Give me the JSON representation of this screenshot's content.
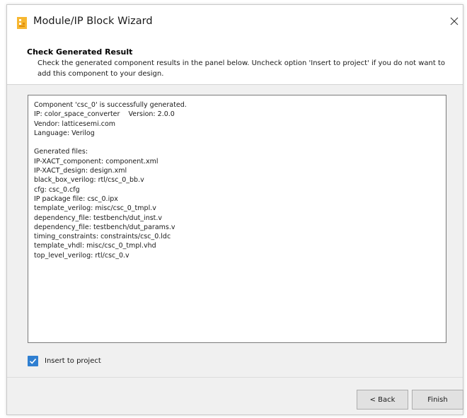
{
  "window": {
    "title": "Module/IP Block Wizard",
    "icon": "lattice-app-icon",
    "close_icon": "close-icon"
  },
  "header": {
    "title": "Check Generated Result",
    "description": "Check the generated component results in the panel below. Uncheck option 'Insert to project' if you do not want to add this component to your design."
  },
  "results_panel": {
    "lines": [
      "Component 'csc_0' is successfully generated.",
      "IP: color_space_converter    Version: 2.0.0",
      "Vendor: latticesemi.com",
      "Language: Verilog",
      "",
      "Generated files:",
      "IP-XACT_component: component.xml",
      "IP-XACT_design: design.xml",
      "black_box_verilog: rtl/csc_0_bb.v",
      "cfg: csc_0.cfg",
      "IP package file: csc_0.ipx",
      "template_verilog: misc/csc_0_tmpl.v",
      "dependency_file: testbench/dut_inst.v",
      "dependency_file: testbench/dut_params.v",
      "timing_constraints: constraints/csc_0.ldc",
      "template_vhdl: misc/csc_0_tmpl.vhd",
      "top_level_verilog: rtl/csc_0.v"
    ]
  },
  "insert_option": {
    "label": "Insert to project",
    "checked": true
  },
  "buttons": {
    "back": "< Back",
    "finish": "Finish"
  },
  "colors": {
    "checkbox_accent": "#2f7fd1",
    "dialog_background": "#f0f0f0",
    "icon_orange": "#f5a623"
  }
}
